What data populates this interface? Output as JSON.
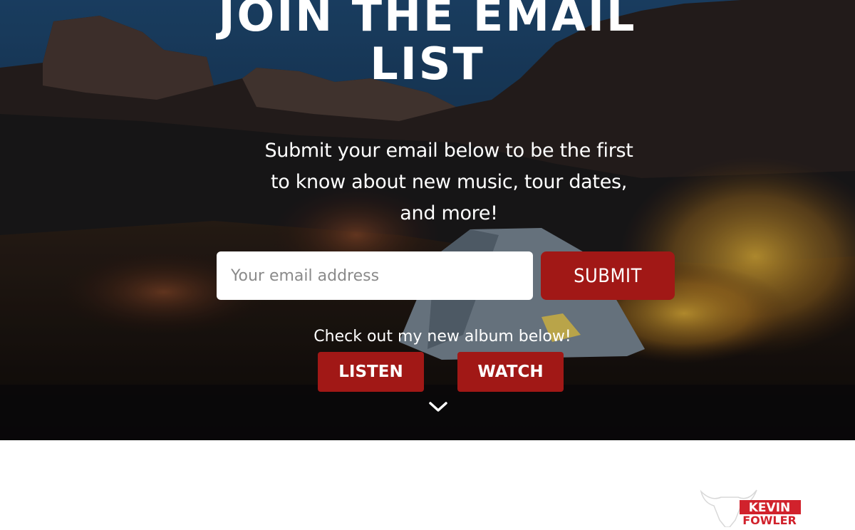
{
  "hero": {
    "title_line1": "JOIN THE EMAIL",
    "title_line2": "LIST",
    "subtitle": "Submit your email below to be the first to know about new music, tour dates, and more!"
  },
  "signup": {
    "email_placeholder": "Your email address",
    "email_value": "",
    "submit_label": "SUBMIT"
  },
  "album": {
    "prompt": "Check out my new album below!",
    "listen_label": "LISTEN",
    "watch_label": "WATCH"
  },
  "scroll": {
    "icon": "chevron-down-icon"
  },
  "brand": {
    "logo_line1": "KEVIN",
    "logo_line2": "FOWLER",
    "logo_icon": "bull-skull-icon"
  },
  "colors": {
    "accent_red": "#a11816",
    "text_white": "#ffffff",
    "page_white": "#ffffff"
  }
}
